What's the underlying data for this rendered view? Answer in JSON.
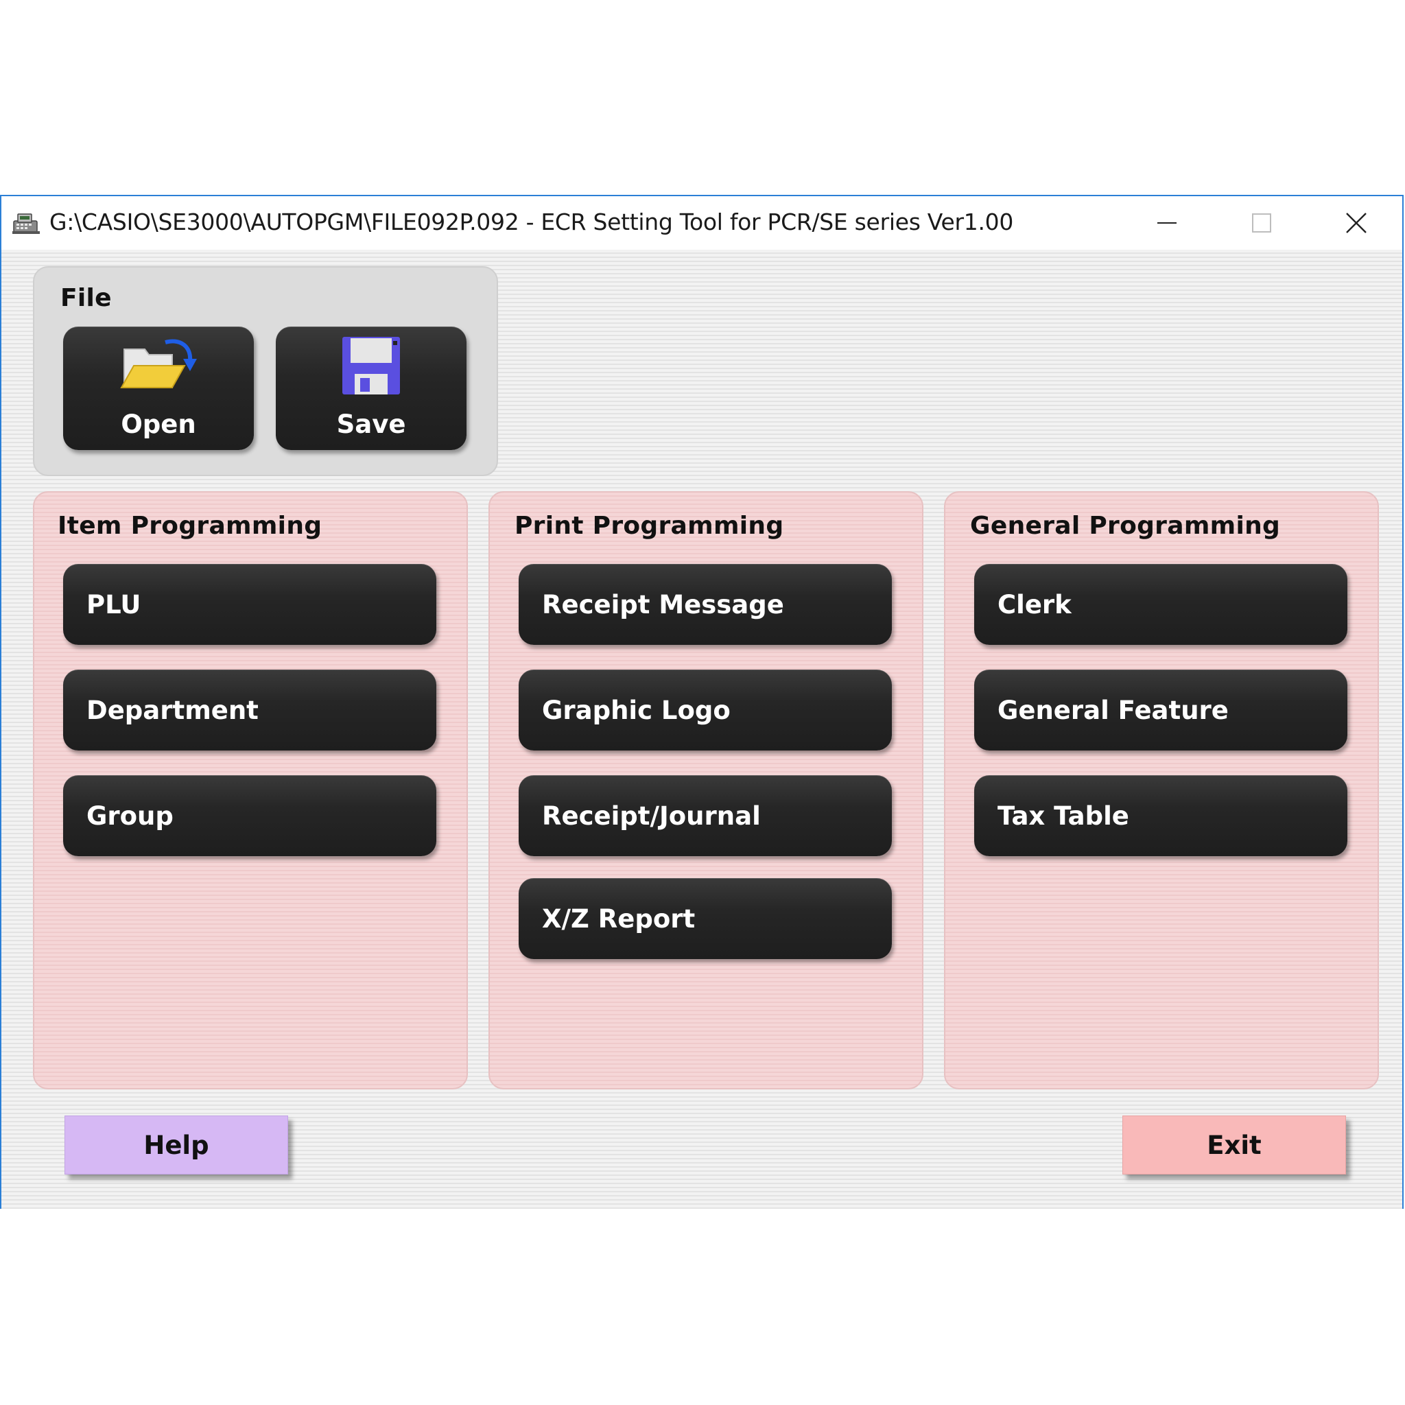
{
  "window": {
    "title": "G:\\CASIO\\SE3000\\AUTOPGM\\FILE092P.092 - ECR Setting Tool for PCR/SE series Ver1.00",
    "icon": "cash-register-icon"
  },
  "file": {
    "title": "File",
    "open_label": "Open",
    "save_label": "Save",
    "open_icon": "open-folder-icon",
    "save_icon": "floppy-disk-icon"
  },
  "item_programming": {
    "title": "Item Programming",
    "buttons": [
      "PLU",
      "Department",
      "Group"
    ]
  },
  "print_programming": {
    "title": "Print Programming",
    "buttons": [
      "Receipt Message",
      "Graphic Logo",
      "Receipt/Journal",
      "X/Z Report"
    ]
  },
  "general_programming": {
    "title": "General Programming",
    "buttons": [
      "Clerk",
      "General Feature",
      "Tax Table"
    ]
  },
  "footer": {
    "help_label": "Help",
    "exit_label": "Exit"
  },
  "colors": {
    "window_border": "#2b7fd6",
    "group_pink": "#f3d2d3",
    "button_dark": "#262626",
    "help": "#d6b8f4",
    "exit": "#f9b9b9"
  }
}
